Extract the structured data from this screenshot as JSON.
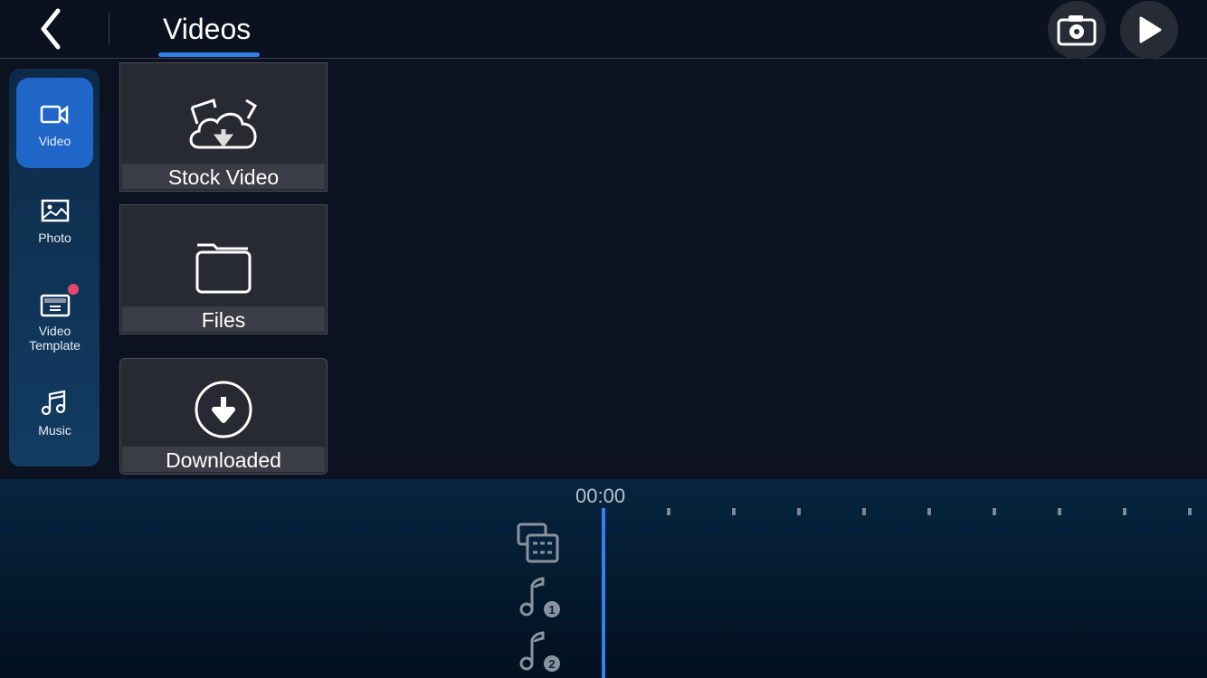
{
  "header": {
    "title": "Videos",
    "back_icon": "chevron-left-icon",
    "camera_icon": "camera-icon",
    "play_icon": "play-icon"
  },
  "sidebar": {
    "items": [
      {
        "label": "Video",
        "icon": "video-camera-icon",
        "active": true
      },
      {
        "label": "Photo",
        "icon": "image-icon"
      },
      {
        "label": "Video\nTemplate",
        "icon": "template-icon",
        "badge": true
      },
      {
        "label": "Music",
        "icon": "music-note-icon"
      }
    ]
  },
  "sources": [
    {
      "label": "Stock Video",
      "icon": "cloud-download-icon"
    },
    {
      "label": "Files",
      "icon": "folder-icon"
    },
    {
      "label": "Downloaded",
      "icon": "download-circle-icon"
    }
  ],
  "timeline": {
    "time": "00:00",
    "tracks": [
      {
        "icon": "media-track-icon"
      },
      {
        "icon": "music-track-icon",
        "number": "1"
      },
      {
        "icon": "music-track-icon",
        "number": "2"
      }
    ]
  },
  "colors": {
    "accent": "#2f7de6",
    "badge": "#e8476a"
  }
}
